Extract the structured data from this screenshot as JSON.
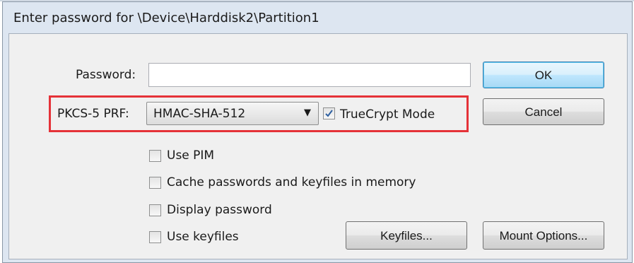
{
  "window": {
    "title": "Enter password for \\Device\\Harddisk2\\Partition1"
  },
  "password": {
    "label": "Password:",
    "value": ""
  },
  "prf": {
    "label": "PKCS-5 PRF:",
    "selected": "HMAC-SHA-512"
  },
  "options": {
    "truecrypt_mode": {
      "label": "TrueCrypt Mode",
      "checked": true
    },
    "use_pim": {
      "label": "Use PIM",
      "checked": false
    },
    "cache": {
      "label": "Cache passwords and keyfiles in memory",
      "checked": false
    },
    "display_password": {
      "label": "Display password",
      "checked": false
    },
    "use_keyfiles": {
      "label": "Use keyfiles",
      "checked": false
    }
  },
  "buttons": {
    "ok": "OK",
    "cancel": "Cancel",
    "keyfiles": "Keyfiles...",
    "mount_options": "Mount Options..."
  },
  "colors": {
    "highlight": "#e53238",
    "checkmark": "#2d5fa0",
    "ok_border": "#3c7fb1"
  },
  "icons": {
    "checkmark": "✓",
    "dropdown_arrow": "▼"
  }
}
